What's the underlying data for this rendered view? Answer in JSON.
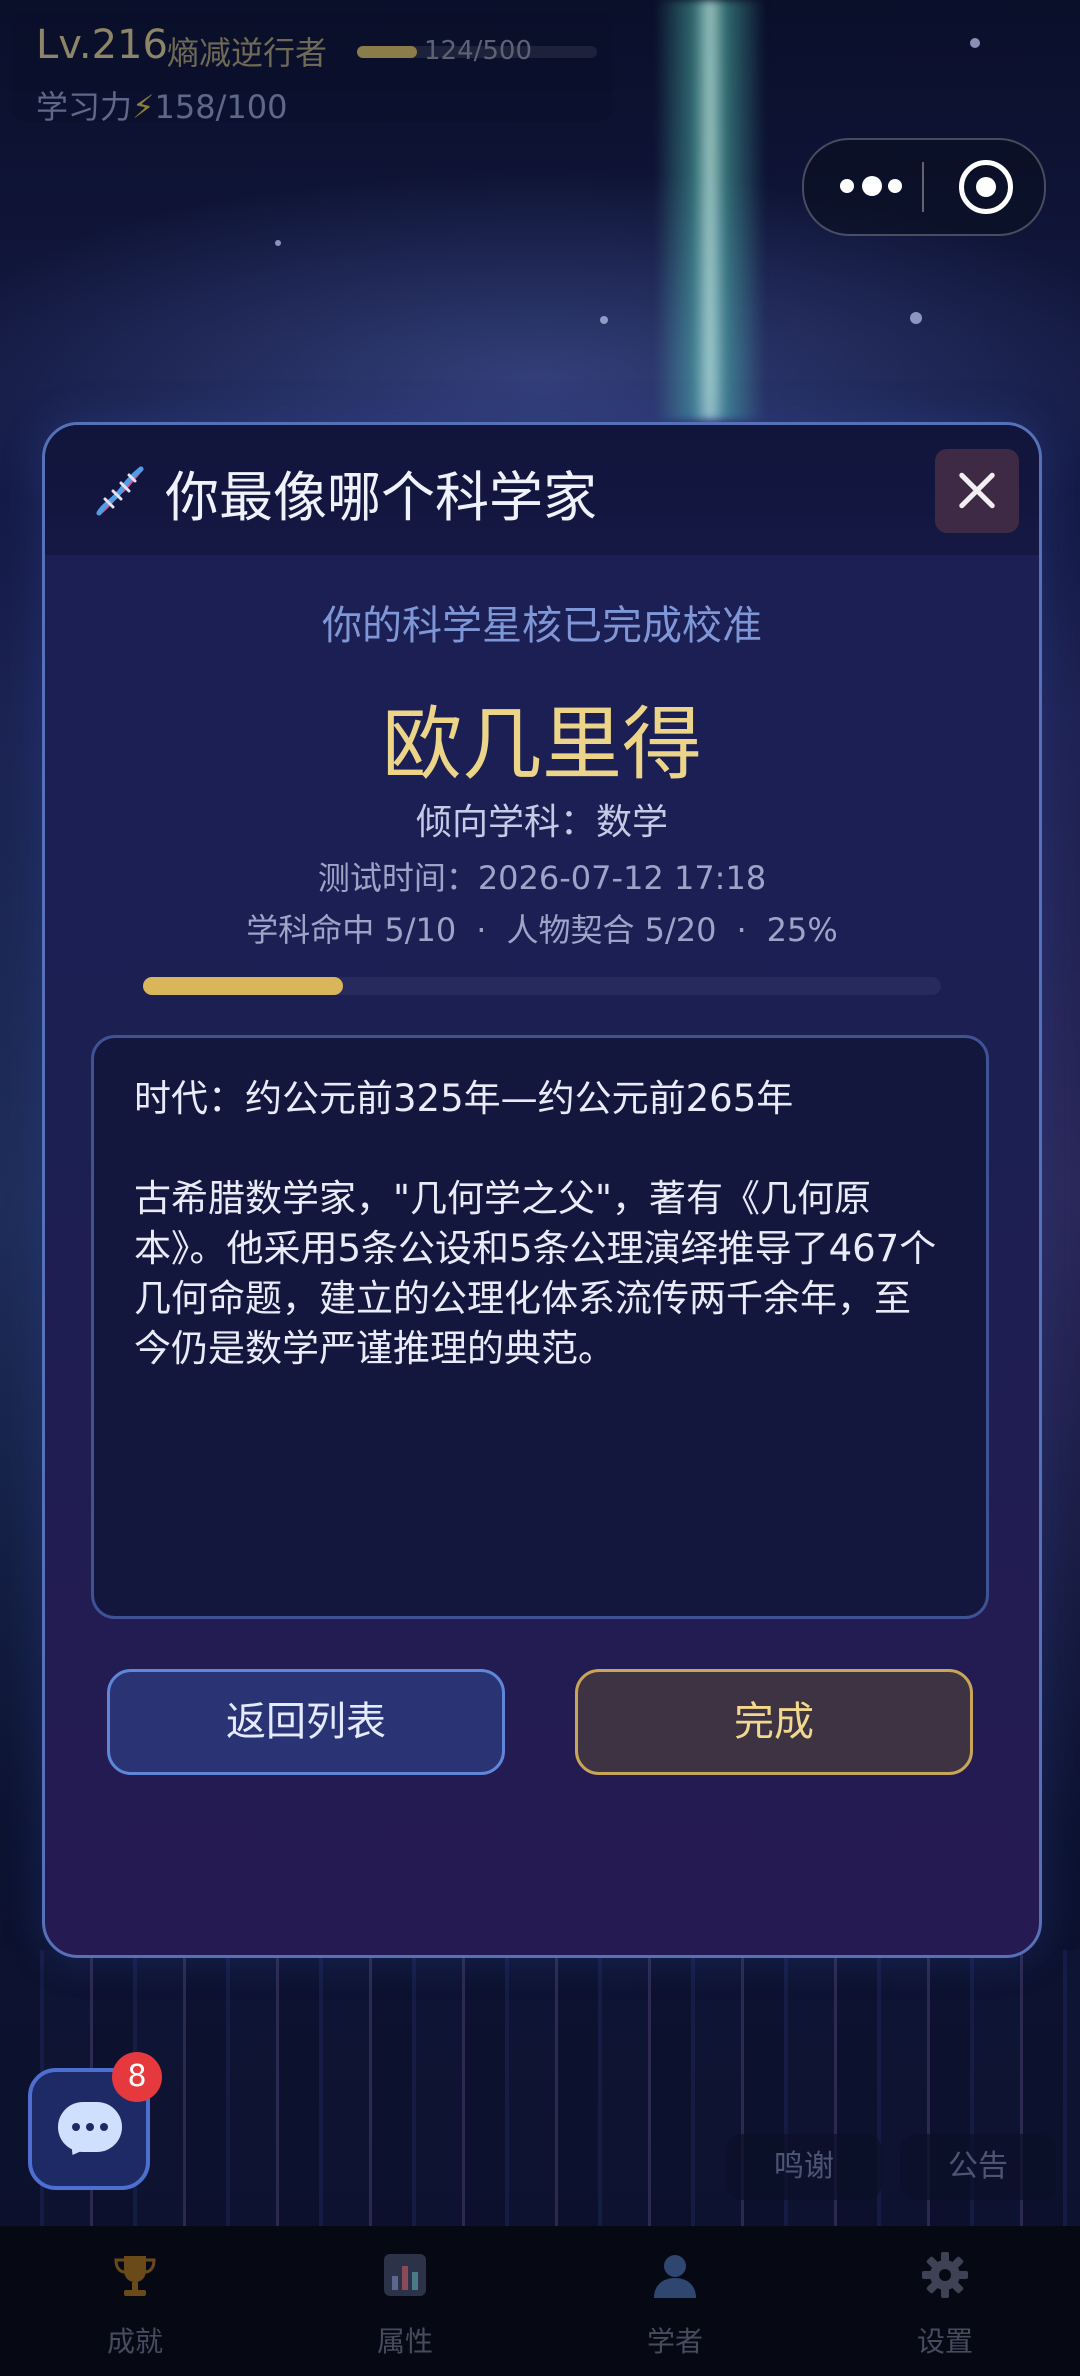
{
  "hud": {
    "level": "Lv.216",
    "player_title": "熵减逆行者",
    "xp_text": "124/500",
    "xp_progress": 0.248,
    "study_power_label": "学习力",
    "study_power_value": "158/100",
    "bolt_icon": "⚡"
  },
  "modal": {
    "title": "你最像哪个科学家",
    "subtitle": "你的科学星核已完成校准",
    "result_name": "欧几里得",
    "subject_line": "倾向学科：数学",
    "time_line": "测试时间：2026-07-12 17:18",
    "stats": {
      "subject_hit": "学科命中 5/10",
      "persona_match": "人物契合 5/20",
      "percent": "25%",
      "separator": "·"
    },
    "progress": 0.25,
    "description": {
      "era": "时代：约公元前325年—约公元前265年",
      "body": "古希腊数学家，\"几何学之父\"，著有《几何原本》。他采用5条公设和5条公理演绎推导了467个几何命题，建立的公理化体系流传两千余年，至今仍是数学严谨推理的典范。"
    },
    "back_button": "返回列表",
    "done_button": "完成"
  },
  "chat": {
    "badge_count": "8"
  },
  "side_pills": {
    "thanks": "鸣谢",
    "notice": "公告"
  },
  "tabbar": {
    "tabs": [
      {
        "label": "成就",
        "icon": "trophy-icon"
      },
      {
        "label": "属性",
        "icon": "chart-icon"
      },
      {
        "label": "学者",
        "icon": "person-icon"
      },
      {
        "label": "设置",
        "icon": "gear-icon"
      }
    ]
  },
  "colors": {
    "accent_gold": "#ecd488",
    "progress_gold": "#d9b65a",
    "accent_blue": "#5f86d8",
    "badge_red": "#e5393d"
  }
}
